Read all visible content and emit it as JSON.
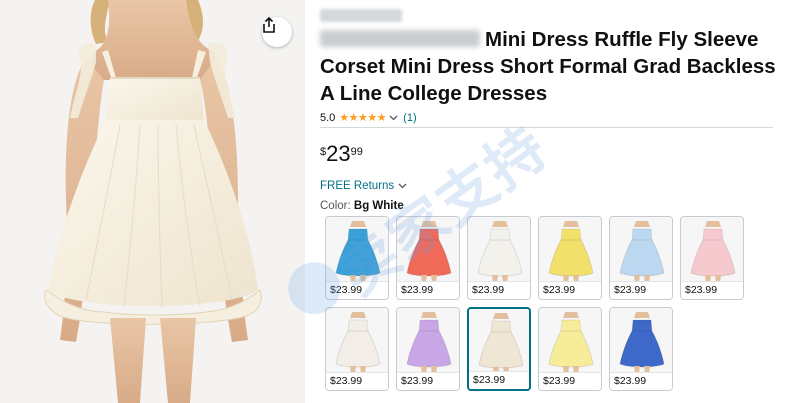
{
  "product": {
    "title": "Mini Dress Ruffle Fly Sleeve Corset Mini Dress Short Formal Grad Backless A Line College Dresses",
    "rating_value": "5.0",
    "stars": 5,
    "rating_count": "(1)",
    "price": {
      "currency": "$",
      "whole": "23",
      "fraction": "99"
    },
    "returns_label": "FREE Returns",
    "color_label": "Color:",
    "color_value": "Bg White"
  },
  "icons": {
    "share": "share-icon",
    "chevron": "chevron-down-icon",
    "star": "star-icon"
  },
  "colors": {
    "link": "#007185",
    "star": "#ff9c1a",
    "selected_border": "#007185"
  },
  "swatches": [
    {
      "name": "Blue",
      "price": "$23.99",
      "color": "#3aa0d8",
      "selected": false
    },
    {
      "name": "Coral",
      "price": "$23.99",
      "color": "#f06a5a",
      "selected": false
    },
    {
      "name": "White",
      "price": "$23.99",
      "color": "#f3f1ec",
      "selected": false
    },
    {
      "name": "Yellow",
      "price": "$23.99",
      "color": "#f1e06a",
      "selected": false
    },
    {
      "name": "Light Blue",
      "price": "$23.99",
      "color": "#bcd8f0",
      "selected": false
    },
    {
      "name": "Pink",
      "price": "$23.99",
      "color": "#f6c9cf",
      "selected": false
    },
    {
      "name": "Floral",
      "price": "$23.99",
      "color": "#f2ede6",
      "selected": false
    },
    {
      "name": "Lavender",
      "price": "$23.99",
      "color": "#c9a7e6",
      "selected": false
    },
    {
      "name": "Bg White",
      "price": "$23.99",
      "color": "#efe6d6",
      "selected": true
    },
    {
      "name": "Light Yellow",
      "price": "$23.99",
      "color": "#f6ec9a",
      "selected": false
    },
    {
      "name": "Royal Blue",
      "price": "$23.99",
      "color": "#3f69c9",
      "selected": false
    }
  ],
  "watermark": "卖家支持"
}
